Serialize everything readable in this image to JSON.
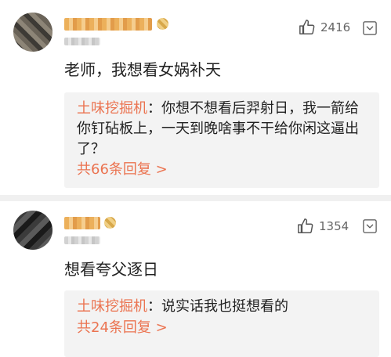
{
  "comments": [
    {
      "like_count": "2416",
      "content": "老师，我想看女娲补天",
      "reply": {
        "user": "土味挖掘机",
        "separator": "：",
        "text": "你想不想看后羿射日，我一箭给你钉砧板上，一天到晚啥事不干给你闲这逼出了？",
        "more": "共66条回复 >"
      }
    },
    {
      "like_count": "1354",
      "content": "想看夸父逐日",
      "reply": {
        "user": "土味挖掘机",
        "separator": "：",
        "text": "说实话我也挺想看的",
        "more": "共24条回复 >"
      }
    }
  ],
  "icons": {
    "like": "thumbs-up-icon",
    "more": "chevron-down-icon"
  },
  "colors": {
    "accent": "#eb7350",
    "reply_bg": "#f3f3f3"
  }
}
